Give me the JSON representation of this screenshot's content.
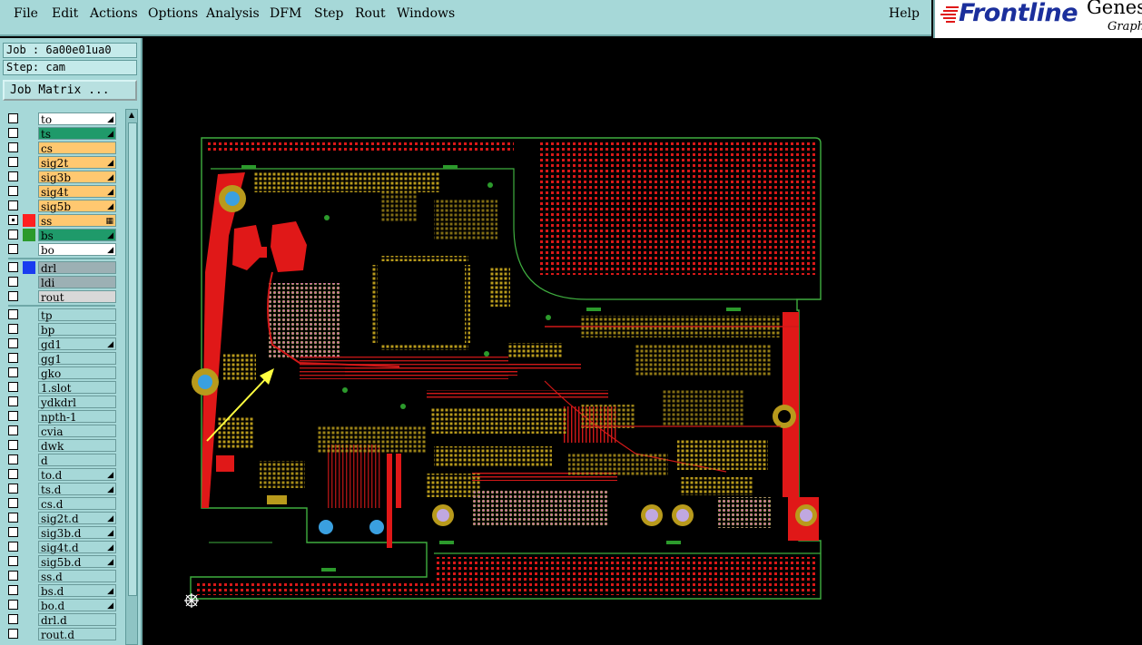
{
  "menu": {
    "items": [
      "File",
      "Edit",
      "Actions",
      "Options",
      "Analysis",
      "DFM",
      "Step",
      "Rout",
      "Windows"
    ],
    "help": "Help"
  },
  "logo": {
    "brand": "Frontline",
    "product": "Genes",
    "sub": "Graph"
  },
  "job": {
    "label": "Job : 6a00e01ua0",
    "step": "Step: cam"
  },
  "job_matrix_button": "Job Matrix ...",
  "layers": [
    {
      "name": "to",
      "bg": "#ffffff",
      "mark": "◢"
    },
    {
      "name": "ts",
      "bg": "#1f9a6a",
      "mark": "◢"
    },
    {
      "name": "cs",
      "bg": "#ffc870",
      "mark": ""
    },
    {
      "name": "sig2t",
      "bg": "#ffc870",
      "mark": "◢"
    },
    {
      "name": "sig3b",
      "bg": "#ffc870",
      "mark": "◢"
    },
    {
      "name": "sig4t",
      "bg": "#ffc870",
      "mark": "◢"
    },
    {
      "name": "sig5b",
      "bg": "#ffc870",
      "mark": "◢"
    },
    {
      "name": "ss",
      "bg": "#ffc870",
      "mark": "▦",
      "swatch": "#ff2020",
      "checked": true
    },
    {
      "name": "bs",
      "bg": "#1f9a6a",
      "mark": "◢",
      "swatch": "#2c9a2c"
    },
    {
      "name": "bo",
      "bg": "#ffffff",
      "mark": "◢"
    },
    {
      "name": "drl",
      "bg": "#9cb0b4",
      "mark": "",
      "swatch": "#1a3cf0"
    },
    {
      "name": "ldi",
      "bg": "#9cb0b4",
      "mark": ""
    },
    {
      "name": "rout",
      "bg": "#d8d8d8",
      "mark": ""
    },
    {
      "name": "tp",
      "bg": "#a6d8d8",
      "mark": ""
    },
    {
      "name": "bp",
      "bg": "#a6d8d8",
      "mark": ""
    },
    {
      "name": "gd1",
      "bg": "#a6d8d8",
      "mark": "◢"
    },
    {
      "name": "gg1",
      "bg": "#a6d8d8",
      "mark": ""
    },
    {
      "name": "gko",
      "bg": "#a6d8d8",
      "mark": ""
    },
    {
      "name": "1.slot",
      "bg": "#a6d8d8",
      "mark": ""
    },
    {
      "name": "ydkdrl",
      "bg": "#a6d8d8",
      "mark": ""
    },
    {
      "name": "npth-1",
      "bg": "#a6d8d8",
      "mark": ""
    },
    {
      "name": "cvia",
      "bg": "#a6d8d8",
      "mark": ""
    },
    {
      "name": "dwk",
      "bg": "#a6d8d8",
      "mark": ""
    },
    {
      "name": "d",
      "bg": "#a6d8d8",
      "mark": ""
    },
    {
      "name": "to.d",
      "bg": "#a6d8d8",
      "mark": "◢"
    },
    {
      "name": "ts.d",
      "bg": "#a6d8d8",
      "mark": "◢"
    },
    {
      "name": "cs.d",
      "bg": "#a6d8d8",
      "mark": ""
    },
    {
      "name": "sig2t.d",
      "bg": "#a6d8d8",
      "mark": "◢"
    },
    {
      "name": "sig3b.d",
      "bg": "#a6d8d8",
      "mark": "◢"
    },
    {
      "name": "sig4t.d",
      "bg": "#a6d8d8",
      "mark": "◢"
    },
    {
      "name": "sig5b.d",
      "bg": "#a6d8d8",
      "mark": "◢"
    },
    {
      "name": "ss.d",
      "bg": "#a6d8d8",
      "mark": ""
    },
    {
      "name": "bs.d",
      "bg": "#a6d8d8",
      "mark": "◢"
    },
    {
      "name": "bo.d",
      "bg": "#a6d8d8",
      "mark": "◢"
    },
    {
      "name": "drl.d",
      "bg": "#a6d8d8",
      "mark": ""
    },
    {
      "name": "rout.d",
      "bg": "#a6d8d8",
      "mark": ""
    }
  ],
  "colors": {
    "panel": "#a6d8d8",
    "board_outline": "#3fae3f",
    "copper_red": "#e01818",
    "pad_gold": "#b89a1c",
    "via_magenta": "#e040e0",
    "hole_blue": "#3aa0e0",
    "arrow_yellow": "#ffff40"
  }
}
